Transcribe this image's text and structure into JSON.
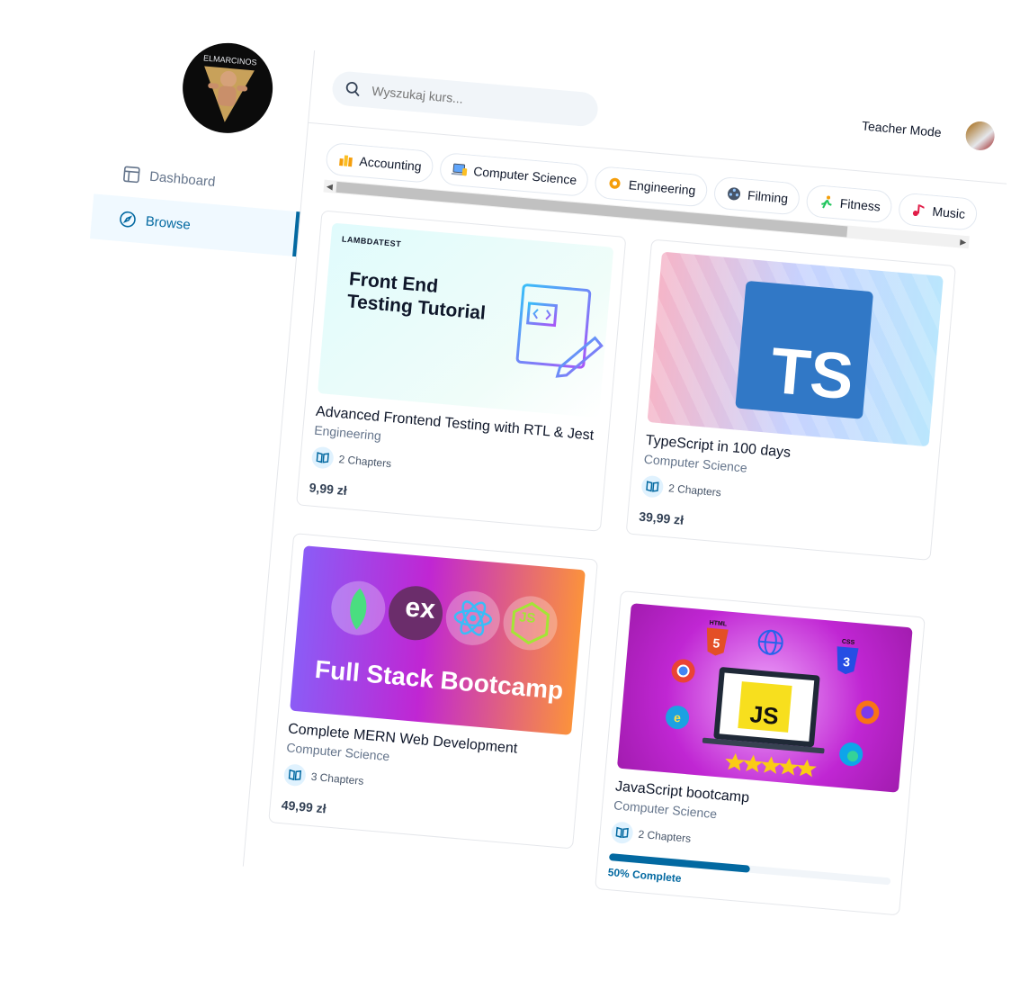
{
  "sidebar": {
    "nav": [
      {
        "label": "Dashboard",
        "icon": "layout-icon"
      },
      {
        "label": "Browse",
        "icon": "compass-icon"
      }
    ]
  },
  "header": {
    "search_placeholder": "Wyszukaj kurs...",
    "teacher_mode": "Teacher Mode"
  },
  "categories": [
    {
      "label": "Accounting",
      "icon": "chart-icon"
    },
    {
      "label": "Computer Science",
      "icon": "laptop-icon"
    },
    {
      "label": "Engineering",
      "icon": "gear-icon"
    },
    {
      "label": "Filming",
      "icon": "film-reel-icon"
    },
    {
      "label": "Fitness",
      "icon": "runner-icon"
    },
    {
      "label": "Music",
      "icon": "music-note-icon"
    }
  ],
  "courses": [
    {
      "title": "Advanced Frontend Testing with RTL & Jest",
      "category": "Engineering",
      "chapters": "2 Chapters",
      "price": "9,99 zł",
      "thumb": {
        "brand": "LAMBDATEST",
        "headline1": "Front End",
        "headline2": "Testing Tutorial"
      }
    },
    {
      "title": "TypeScript in 100 days",
      "category": "Computer Science",
      "chapters": "2 Chapters",
      "price": "39,99 zł",
      "thumb": {
        "logo": "TS"
      }
    },
    {
      "title": "Complete MERN Web Development",
      "category": "Computer Science",
      "chapters": "3 Chapters",
      "price": "49,99 zł",
      "thumb": {
        "headline": "Full Stack Bootcamp",
        "badge_ex": "ex",
        "badge_js": "JS"
      }
    },
    {
      "title": "JavaScript bootcamp",
      "category": "Computer Science",
      "chapters": "2 Chapters",
      "progress": 0.5,
      "progress_label": "50% Complete",
      "thumb": {
        "logo": "JS",
        "html": "HTML",
        "css": "CSS",
        "html_num": "5",
        "css_num": "3"
      }
    }
  ],
  "colors": {
    "accent": "#0369a1",
    "border": "#e5e7eb"
  }
}
